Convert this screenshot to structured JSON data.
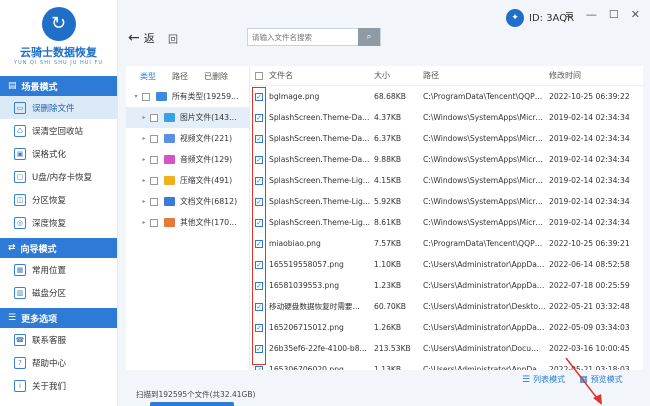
{
  "logo": {
    "title": "云骑士数据恢复",
    "subtitle": "YUN QI SHI SHU JU HUI FU"
  },
  "sidebar": {
    "sections": [
      {
        "label": "场景模式",
        "items": [
          {
            "label": "误删除文件",
            "active": true
          },
          {
            "label": "误清空回收站"
          },
          {
            "label": "误格式化"
          },
          {
            "label": "U盘/内存卡恢复"
          },
          {
            "label": "分区恢复"
          },
          {
            "label": "深度恢复"
          }
        ]
      },
      {
        "label": "向导模式",
        "items": [
          {
            "label": "常用位置"
          },
          {
            "label": "磁盘分区"
          }
        ]
      },
      {
        "label": "更多选项",
        "items": [
          {
            "label": "联系客服"
          },
          {
            "label": "帮助中心"
          },
          {
            "label": "关于我们"
          }
        ]
      }
    ]
  },
  "topbar": {
    "user_id": "ID: 3AQR",
    "back_label": "返",
    "home_label": "回",
    "search_placeholder": "请输入文件名搜索"
  },
  "tree": {
    "tabs": [
      "类型",
      "路径",
      "已删除"
    ],
    "rows": [
      {
        "label": "所有类型(19259...",
        "color": "#3c8be0",
        "level": 0
      },
      {
        "label": "图片文件(143...",
        "color": "#3aa0e8",
        "level": 1,
        "selected": true
      },
      {
        "label": "视频文件(221)",
        "color": "#5b8ee6",
        "level": 1
      },
      {
        "label": "音频文件(129)",
        "color": "#d454c6",
        "level": 1
      },
      {
        "label": "压缩文件(491)",
        "color": "#f2b01e",
        "level": 1
      },
      {
        "label": "文档文件(6812)",
        "color": "#3b7ad8",
        "level": 1
      },
      {
        "label": "其他文件(170...",
        "color": "#e8773a",
        "level": 1
      }
    ]
  },
  "list": {
    "headers": {
      "name": "文件名",
      "size": "大小",
      "path": "路径",
      "time": "修改时间"
    },
    "rows": [
      {
        "name": "bgImage.png",
        "size": "68.68KB",
        "path": "C:\\ProgramData\\Tencent\\QQPC...",
        "time": "2022-10-25 06:39:22"
      },
      {
        "name": "SplashScreen.Theme-Da...",
        "size": "4.37KB",
        "path": "C:\\Windows\\SystemApps\\Micros...",
        "time": "2019-02-14 02:34:34"
      },
      {
        "name": "SplashScreen.Theme-Da...",
        "size": "6.37KB",
        "path": "C:\\Windows\\SystemApps\\Micros...",
        "time": "2019-02-14 02:34:34"
      },
      {
        "name": "SplashScreen.Theme-Da...",
        "size": "9.88KB",
        "path": "C:\\Windows\\SystemApps\\Micros...",
        "time": "2019-02-14 02:34:34"
      },
      {
        "name": "SplashScreen.Theme-Lig...",
        "size": "4.15KB",
        "path": "C:\\Windows\\SystemApps\\Micros...",
        "time": "2019-02-14 02:34:34"
      },
      {
        "name": "SplashScreen.Theme-Lig...",
        "size": "5.92KB",
        "path": "C:\\Windows\\SystemApps\\Micros...",
        "time": "2019-02-14 02:34:34"
      },
      {
        "name": "SplashScreen.Theme-Lig...",
        "size": "8.61KB",
        "path": "C:\\Windows\\SystemApps\\Micros...",
        "time": "2019-02-14 02:34:34"
      },
      {
        "name": "miaobiao.png",
        "size": "7.57KB",
        "path": "C:\\ProgramData\\Tencent\\QQPC...",
        "time": "2022-10-25 06:39:21"
      },
      {
        "name": "165519558057.png",
        "size": "1.10KB",
        "path": "C:\\Users\\Administrator\\AppData...",
        "time": "2022-06-14 08:52:58"
      },
      {
        "name": "16581039553.png",
        "size": "1.23KB",
        "path": "C:\\Users\\Administrator\\AppData...",
        "time": "2022-07-18 00:25:59"
      },
      {
        "name": "移动硬盘数据恢复时需要...",
        "size": "60.70KB",
        "path": "C:\\Users\\Administrator\\Desktop...",
        "time": "2022-05-21 03:32:48"
      },
      {
        "name": "165206715012.png",
        "size": "1.26KB",
        "path": "C:\\Users\\Administrator\\AppData...",
        "time": "2022-05-09 03:34:03"
      },
      {
        "name": "26b35ef6-22fe-4100-b8...",
        "size": "213.53KB",
        "path": "C:\\Users\\Administrator\\Docume...",
        "time": "2022-03-16 10:00:45"
      },
      {
        "name": "165306706020.png",
        "size": "1.13KB",
        "path": "C:\\Users\\Administrator\\AppData...",
        "time": "2022-05-21 03:18:03"
      }
    ]
  },
  "status": "扫描到192595个文件(共32.41GB)",
  "views": {
    "list": "列表模式",
    "preview": "预览模式"
  },
  "colors": {
    "accent": "#2d7bd6",
    "highlight": "#e0332f"
  }
}
